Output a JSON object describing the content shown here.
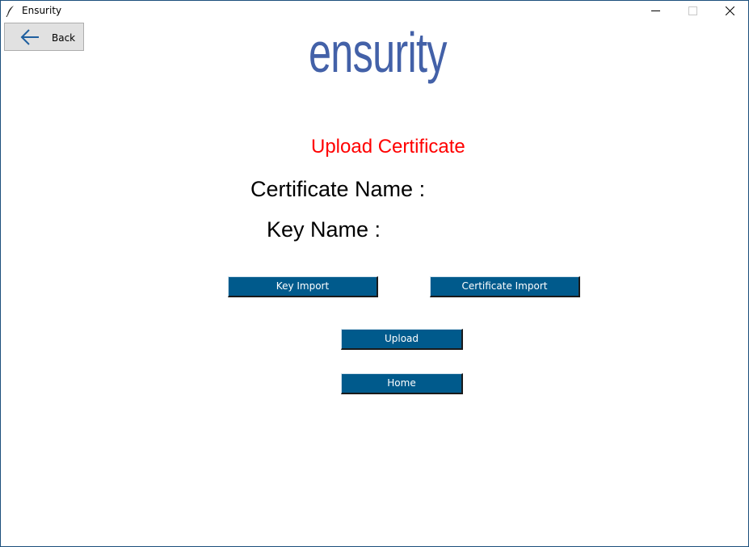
{
  "window": {
    "title": "Ensurity",
    "controls": [
      "minimize-icon",
      "maximize-icon",
      "close-icon"
    ]
  },
  "toolbar": {
    "back_label": "Back",
    "back_icon": "arrow-left-icon"
  },
  "logo": {
    "text": "ensurity",
    "color": "#4361a8"
  },
  "page": {
    "heading": "Upload Certificate",
    "heading_color": "#ff0000",
    "certificate_name_label": "Certificate Name :",
    "key_name_label": "Key Name :"
  },
  "buttons": {
    "key_import": "Key Import",
    "certificate_import": "Certificate Import",
    "upload": "Upload",
    "home": "Home",
    "color": "#005a8c"
  }
}
